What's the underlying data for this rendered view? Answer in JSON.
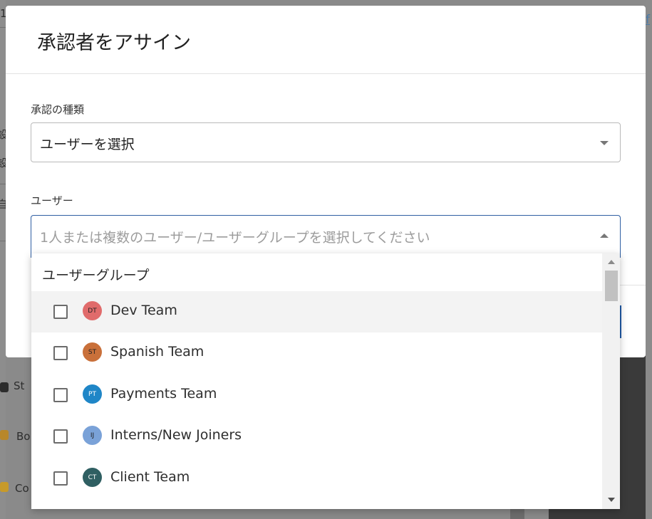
{
  "background": {
    "link_fragment": "f",
    "fragments": [
      "St",
      "Bo",
      "Co",
      "設",
      "設",
      "自",
      "1"
    ]
  },
  "modal": {
    "title": "承認者をアサイン",
    "approval_type": {
      "label": "承認の種類",
      "value": "ユーザーを選択"
    },
    "users": {
      "label": "ユーザー",
      "placeholder": "1人または複数のユーザー/ユーザーグループを選択してください"
    }
  },
  "dropdown": {
    "group_header": "ユーザーグループ",
    "options": [
      {
        "initials": "DT",
        "label": "Dev Team",
        "color": "#e06b6b",
        "checked": false
      },
      {
        "initials": "ST",
        "label": "Spanish Team",
        "color": "#c9703a",
        "checked": false
      },
      {
        "initials": "PT",
        "label": "Payments Team",
        "color": "#1f86c7",
        "checked": false
      },
      {
        "initials": "IJ",
        "label": "Interns/New Joiners",
        "color": "#7aa2d8",
        "checked": false
      },
      {
        "initials": "CT",
        "label": "Client Team",
        "color": "#2f5f62",
        "checked": false
      }
    ]
  },
  "colors": {
    "accent": "#2f5fa3",
    "text": "#212121",
    "placeholder": "#9c9c9c"
  }
}
